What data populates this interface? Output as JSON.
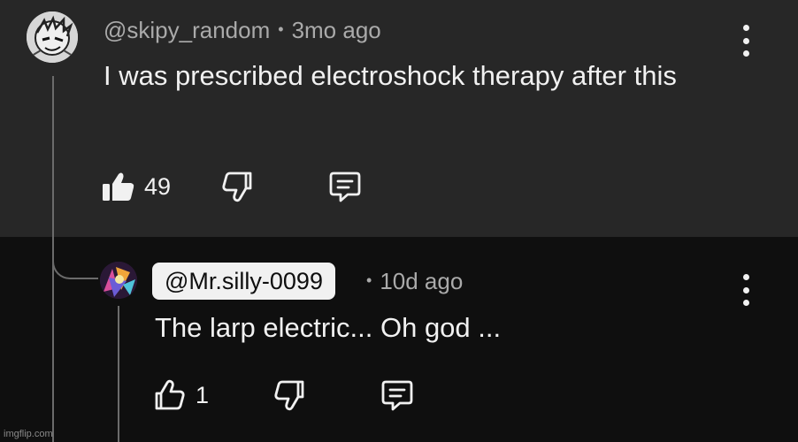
{
  "parent_comment": {
    "handle": "@skipy_random",
    "age": "3mo ago",
    "separator": "•",
    "text": "I was prescribed electroshock therapy after this",
    "like_count": "49",
    "like_state": "liked",
    "icons": [
      "thumbs-up-filled-icon",
      "thumbs-down-icon",
      "reply-icon",
      "more-vert-icon"
    ]
  },
  "reply_comment": {
    "handle": "@Mr.silly-0099",
    "age": "10d ago",
    "separator": "•",
    "text": "The larp electric... Oh god ...",
    "like_count": "1",
    "like_state": "not-liked",
    "icons": [
      "thumbs-up-icon",
      "thumbs-down-icon",
      "reply-icon",
      "more-vert-icon"
    ]
  },
  "watermark": "imgflip.com",
  "colors": {
    "top_background": "#272727",
    "bottom_background": "#0f0f0f",
    "text": "#f1f1f1",
    "meta_text": "#aaaaaa",
    "thread_line": "#6b6b6b"
  }
}
